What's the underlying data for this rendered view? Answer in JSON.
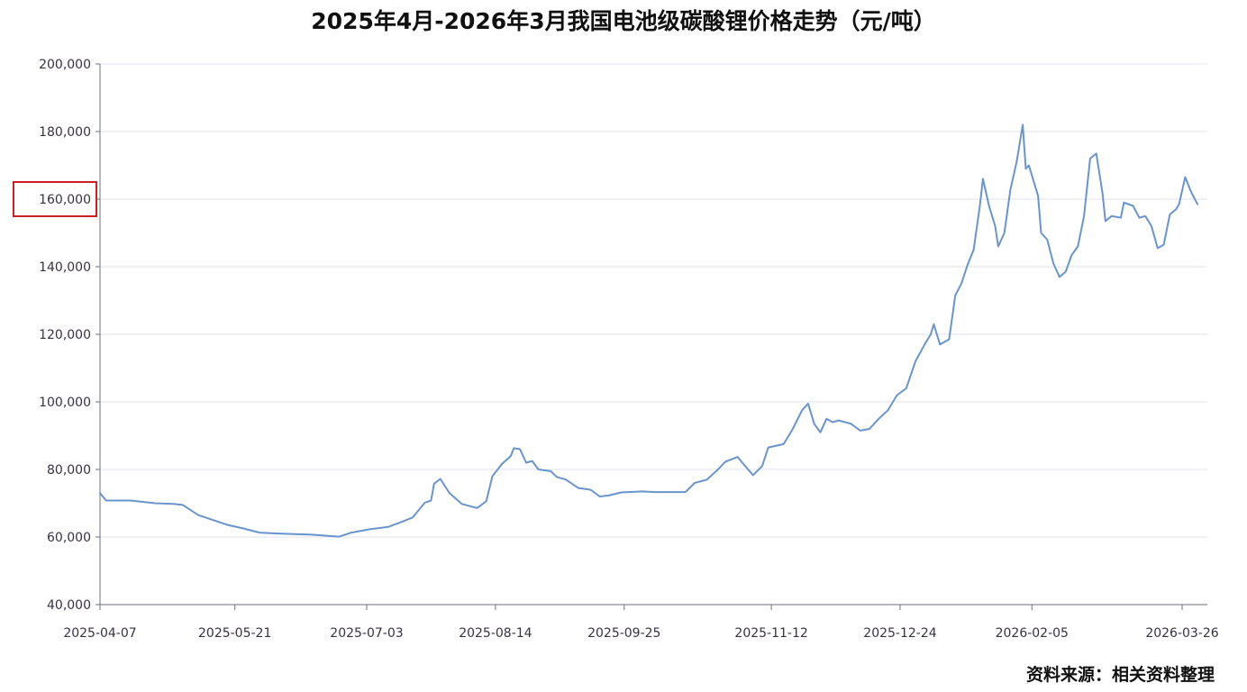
{
  "title": "2025年4月-2026年3月我国电池级碳酸锂价格走势（元/吨）",
  "source": "资料来源：相关资料整理",
  "colors": {
    "line": "#6a94cc",
    "grid": "#dfe3ee",
    "axis": "#6e7079",
    "highlight": "#cc1f1f"
  },
  "chart_data": {
    "type": "line",
    "title": "2025年4月-2026年3月我国电池级碳酸锂价格走势（元/吨）",
    "xlabel": "",
    "ylabel": "",
    "ylim": [
      40000,
      200000
    ],
    "grid": true,
    "y_ticks": [
      "40,000",
      "60,000",
      "80,000",
      "100,000",
      "120,000",
      "140,000",
      "160,000",
      "180,000",
      "200,000"
    ],
    "x_ticks": [
      "2025-04-07",
      "2025-05-21",
      "2025-07-03",
      "2025-08-14",
      "2025-09-25",
      "2025-11-12",
      "2025-12-24",
      "2026-02-05",
      "2026-03-26"
    ],
    "highlighted_tick": "160,000",
    "series": [
      {
        "points": [
          [
            "2025-04-07",
            73000
          ],
          [
            "2025-04-09",
            70800
          ],
          [
            "2025-04-17",
            70800
          ],
          [
            "2025-04-25",
            70000
          ],
          [
            "2025-05-01",
            69800
          ],
          [
            "2025-05-04",
            69500
          ],
          [
            "2025-05-09",
            66500
          ],
          [
            "2025-05-14",
            65000
          ],
          [
            "2025-05-19",
            63500
          ],
          [
            "2025-05-24",
            62500
          ],
          [
            "2025-05-29",
            61300
          ],
          [
            "2025-06-05",
            61000
          ],
          [
            "2025-06-15",
            60700
          ],
          [
            "2025-06-24",
            60100
          ],
          [
            "2025-06-28",
            61300
          ],
          [
            "2025-07-04",
            62300
          ],
          [
            "2025-07-10",
            63000
          ],
          [
            "2025-07-15",
            64700
          ],
          [
            "2025-07-18",
            65800
          ],
          [
            "2025-07-22",
            70200
          ],
          [
            "2025-07-24",
            70800
          ],
          [
            "2025-07-25",
            75800
          ],
          [
            "2025-07-27",
            77200
          ],
          [
            "2025-07-30",
            73000
          ],
          [
            "2025-08-03",
            69800
          ],
          [
            "2025-08-08",
            68600
          ],
          [
            "2025-08-11",
            70600
          ],
          [
            "2025-08-13",
            78000
          ],
          [
            "2025-08-16",
            81500
          ],
          [
            "2025-08-19",
            84000
          ],
          [
            "2025-08-20",
            86300
          ],
          [
            "2025-08-22",
            86000
          ],
          [
            "2025-08-24",
            82000
          ],
          [
            "2025-08-26",
            82500
          ],
          [
            "2025-08-28",
            80000
          ],
          [
            "2025-09-01",
            79500
          ],
          [
            "2025-09-03",
            77800
          ],
          [
            "2025-09-06",
            77000
          ],
          [
            "2025-09-10",
            74500
          ],
          [
            "2025-09-14",
            74000
          ],
          [
            "2025-09-17",
            72000
          ],
          [
            "2025-09-20",
            72300
          ],
          [
            "2025-09-24",
            73200
          ],
          [
            "2025-10-01",
            73500
          ],
          [
            "2025-10-05",
            73300
          ],
          [
            "2025-10-15",
            73300
          ],
          [
            "2025-10-18",
            76000
          ],
          [
            "2025-10-22",
            77000
          ],
          [
            "2025-10-25",
            79500
          ],
          [
            "2025-10-28",
            82300
          ],
          [
            "2025-11-01",
            83700
          ],
          [
            "2025-11-03",
            81500
          ],
          [
            "2025-11-06",
            78300
          ],
          [
            "2025-11-09",
            81000
          ],
          [
            "2025-11-11",
            86500
          ],
          [
            "2025-11-16",
            87500
          ],
          [
            "2025-11-19",
            92000
          ],
          [
            "2025-11-22",
            97500
          ],
          [
            "2025-11-24",
            99500
          ],
          [
            "2025-11-26",
            93500
          ],
          [
            "2025-11-28",
            91000
          ],
          [
            "2025-11-30",
            95000
          ],
          [
            "2025-12-02",
            94000
          ],
          [
            "2025-12-04",
            94500
          ],
          [
            "2025-12-08",
            93500
          ],
          [
            "2025-12-11",
            91500
          ],
          [
            "2025-12-14",
            92000
          ],
          [
            "2025-12-17",
            95000
          ],
          [
            "2025-12-20",
            97500
          ],
          [
            "2025-12-23",
            102000
          ],
          [
            "2025-12-26",
            104000
          ],
          [
            "2025-12-29",
            112000
          ],
          [
            "2026-01-01",
            117000
          ],
          [
            "2026-01-03",
            120000
          ],
          [
            "2026-01-04",
            123000
          ],
          [
            "2026-01-06",
            117000
          ],
          [
            "2026-01-09",
            118500
          ],
          [
            "2026-01-11",
            131500
          ],
          [
            "2026-01-13",
            135000
          ],
          [
            "2026-01-15",
            140500
          ],
          [
            "2026-01-17",
            145000
          ],
          [
            "2026-01-19",
            158000
          ],
          [
            "2026-01-20",
            166000
          ],
          [
            "2026-01-22",
            158000
          ],
          [
            "2026-01-24",
            152000
          ],
          [
            "2026-01-25",
            146000
          ],
          [
            "2026-01-27",
            150000
          ],
          [
            "2026-01-29",
            163000
          ],
          [
            "2026-01-31",
            171000
          ],
          [
            "2026-02-02",
            182000
          ],
          [
            "2026-02-03",
            169000
          ],
          [
            "2026-02-04",
            170000
          ],
          [
            "2026-02-07",
            161000
          ],
          [
            "2026-02-08",
            150000
          ],
          [
            "2026-02-10",
            148000
          ],
          [
            "2026-02-12",
            141000
          ],
          [
            "2026-02-14",
            137000
          ],
          [
            "2026-02-16",
            138500
          ],
          [
            "2026-02-18",
            143500
          ],
          [
            "2026-02-20",
            146000
          ],
          [
            "2026-02-22",
            155000
          ],
          [
            "2026-02-24",
            172000
          ],
          [
            "2026-02-26",
            173500
          ],
          [
            "2026-02-28",
            162000
          ],
          [
            "2026-03-01",
            153500
          ],
          [
            "2026-03-03",
            155000
          ],
          [
            "2026-03-06",
            154500
          ],
          [
            "2026-03-07",
            159000
          ],
          [
            "2026-03-10",
            158000
          ],
          [
            "2026-03-12",
            154500
          ],
          [
            "2026-03-14",
            155000
          ],
          [
            "2026-03-16",
            152000
          ],
          [
            "2026-03-18",
            145500
          ],
          [
            "2026-03-20",
            146500
          ],
          [
            "2026-03-22",
            155500
          ],
          [
            "2026-03-24",
            157000
          ],
          [
            "2026-03-25",
            158500
          ],
          [
            "2026-03-27",
            166500
          ],
          [
            "2026-03-29",
            162000
          ],
          [
            "2026-03-31",
            158500
          ]
        ]
      }
    ]
  }
}
